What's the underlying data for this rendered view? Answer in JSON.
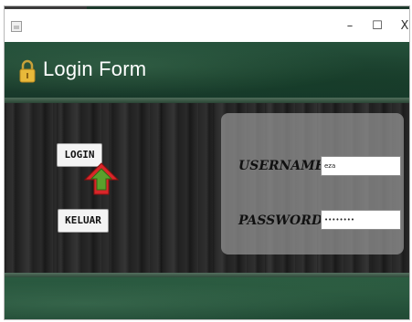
{
  "window": {
    "title_bar": {
      "minimize_glyph": "–",
      "maximize_glyph": "☐",
      "close_glyph": "X"
    }
  },
  "header": {
    "icon": "lock-icon",
    "title": "Login Form"
  },
  "actions": {
    "login_label": "LOGIN",
    "exit_label": "KELUAR"
  },
  "form": {
    "username_label": "USERNAME",
    "username_value": "eza",
    "password_label": "PASSWORD",
    "password_value": "••••••••"
  },
  "colors": {
    "header_green": "#1f4a34",
    "panel_gray": "#9a9a9a",
    "cursor_red": "#d9262a",
    "cursor_green": "#5aa02c"
  }
}
